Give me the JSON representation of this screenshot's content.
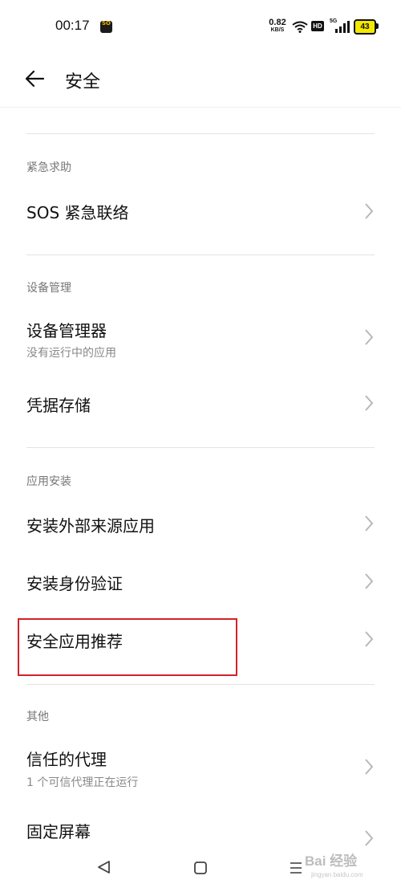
{
  "status_bar": {
    "time": "00:17",
    "notification_badge": "SO",
    "net_speed_value": "0.82",
    "net_speed_unit": "KB/S",
    "hd_label": "HD",
    "signal_label": "5G",
    "battery_level": "43",
    "battery_color": "#f3e800"
  },
  "header": {
    "back_icon": "arrow-left-icon",
    "title": "安全"
  },
  "sections": [
    {
      "label": "紧急求助",
      "items": [
        {
          "title": "SOS 紧急联络",
          "subtitle": ""
        }
      ]
    },
    {
      "label": "设备管理",
      "items": [
        {
          "title": "设备管理器",
          "subtitle": "没有运行中的应用"
        },
        {
          "title": "凭据存储",
          "subtitle": ""
        }
      ]
    },
    {
      "label": "应用安装",
      "items": [
        {
          "title": "安装外部来源应用",
          "subtitle": ""
        },
        {
          "title": "安装身份验证",
          "subtitle": ""
        },
        {
          "title": "安全应用推荐",
          "subtitle": ""
        }
      ]
    },
    {
      "label": "其他",
      "items": [
        {
          "title": "信任的代理",
          "subtitle": "1 个可信代理正在运行"
        },
        {
          "title": "固定屏幕",
          "subtitle": ""
        }
      ]
    }
  ],
  "highlight_color": "#d2232a",
  "navbar": {
    "back_icon": "triangle-back-icon",
    "home_icon": "square-home-icon",
    "menu_icon": "menu-lines-icon"
  },
  "watermark": {
    "text": "Bai 经验",
    "sub": "jingyan.baidu.com"
  }
}
